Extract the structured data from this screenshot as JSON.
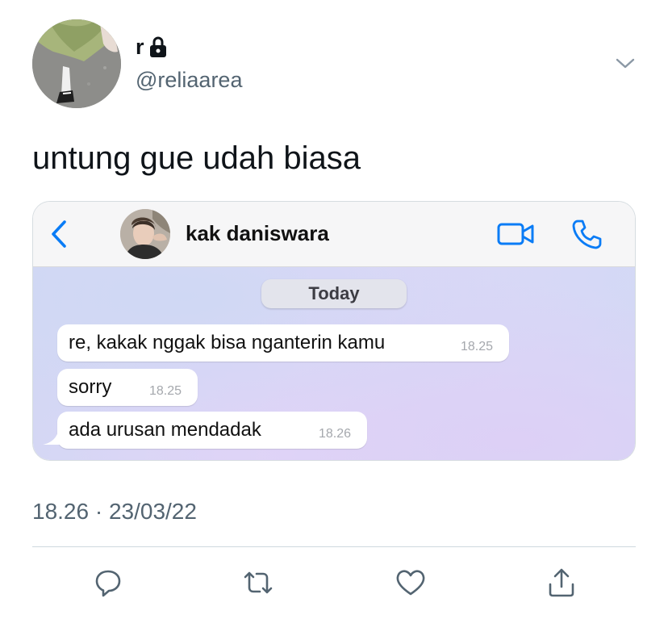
{
  "tweet": {
    "display_name": "r",
    "handle": "@reliaarea",
    "protected_icon": "lock-icon",
    "menu_icon": "chevron-down-icon",
    "text": "untung gue udah biasa",
    "timestamp": "18.26 · 23/03/22"
  },
  "chat": {
    "contact_name": "kak daniswara",
    "back_icon": "chevron-left-icon",
    "video_icon": "video-camera-icon",
    "call_icon": "phone-icon",
    "date_label": "Today",
    "accent_color": "#0a7cf6",
    "messages": [
      {
        "text": "re, kakak nggak bisa nganterin kamu",
        "time": "18.25"
      },
      {
        "text": "sorry",
        "time": "18.25"
      },
      {
        "text": "ada urusan mendadak",
        "time": "18.26"
      }
    ]
  },
  "actions": [
    {
      "name": "reply",
      "icon": "reply-icon"
    },
    {
      "name": "retweet",
      "icon": "retweet-icon"
    },
    {
      "name": "like",
      "icon": "heart-icon"
    },
    {
      "name": "share",
      "icon": "share-icon"
    }
  ]
}
